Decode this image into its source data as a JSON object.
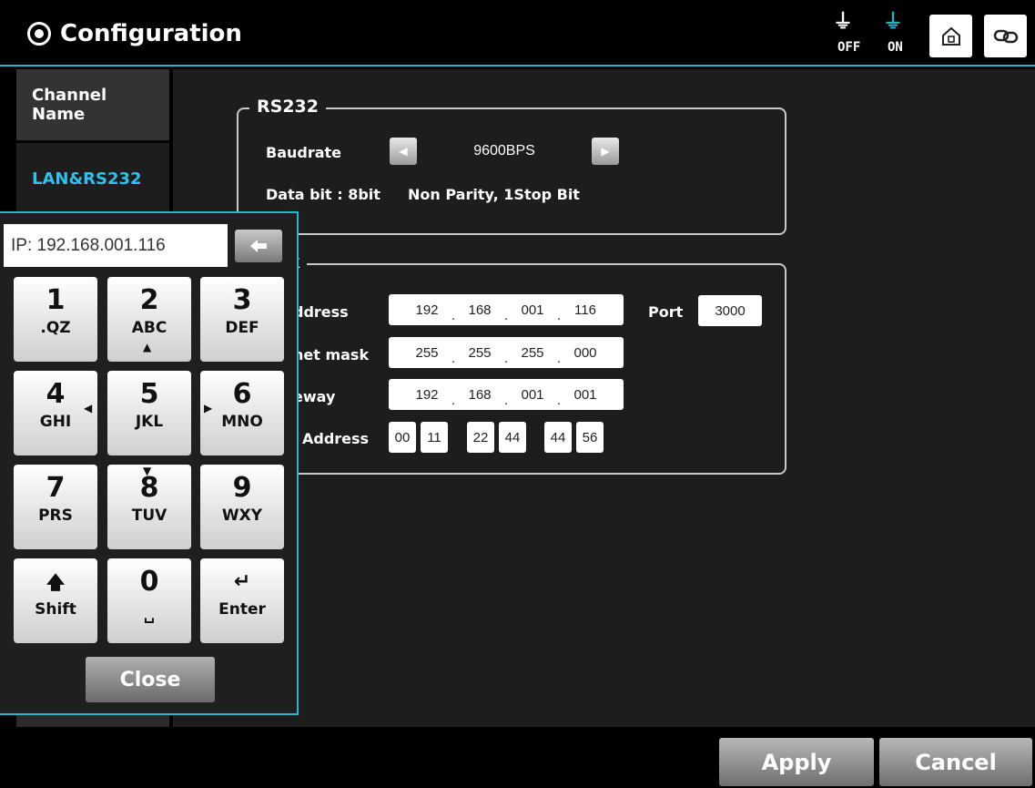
{
  "header": {
    "title": "Configuration",
    "title_icon": "gear-icon",
    "plug_off_label": "OFF",
    "plug_on_label": "ON",
    "home_icon": "home-icon",
    "link_icon": "link-icon",
    "accent_color": "#2ab6c6"
  },
  "tabs": [
    {
      "label_line1": "Channel",
      "label_line2": "Name",
      "selected": false
    },
    {
      "label": "LAN&RS232",
      "selected": true,
      "color": "#2fc0ee"
    }
  ],
  "rs232": {
    "legend": "RS232",
    "baudrate_label": "Baudrate",
    "baudrate_value": "9600BPS",
    "databit_text": "Data bit : 8bit",
    "parity_text": "Non Parity, 1Stop Bit"
  },
  "network": {
    "legend": "vork",
    "ip_label": "ddress",
    "ip": [
      "192",
      "168",
      "001",
      "116"
    ],
    "port_label": "Port",
    "port_value": "3000",
    "subnet_label": "net mask",
    "subnet": [
      "255",
      "255",
      "255",
      "000"
    ],
    "gateway_label": "eway",
    "gateway": [
      "192",
      "168",
      "001",
      "001"
    ],
    "mac_label": "Address",
    "mac": [
      "00",
      "11",
      "22",
      "44",
      "44",
      "56"
    ]
  },
  "keypad": {
    "display": "IP: 192.168.001.116",
    "keys": [
      {
        "num": "1",
        "sub": ".QZ"
      },
      {
        "num": "2",
        "sub": "ABC"
      },
      {
        "num": "3",
        "sub": "DEF"
      },
      {
        "num": "4",
        "sub": "GHI"
      },
      {
        "num": "5",
        "sub": "JKL"
      },
      {
        "num": "6",
        "sub": "MNO"
      },
      {
        "num": "7",
        "sub": "PRS"
      },
      {
        "num": "8",
        "sub": "TUV"
      },
      {
        "num": "9",
        "sub": "WXY"
      },
      {
        "num": "",
        "sub": "Shift"
      },
      {
        "num": "0",
        "sub": ""
      },
      {
        "num": "",
        "sub": "Enter"
      }
    ],
    "close_label": "Close"
  },
  "footer": {
    "apply_label": "Apply",
    "cancel_label": "Cancel"
  }
}
